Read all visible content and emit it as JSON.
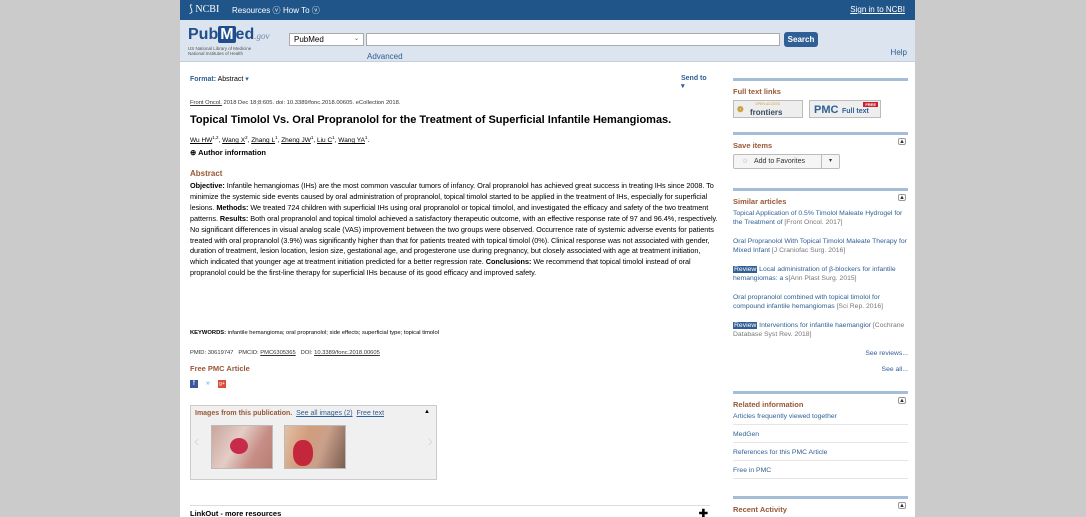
{
  "topbar": {
    "logo": "NCBI",
    "resources": "Resources ⓥ",
    "howto": "How To ⓥ",
    "signin": "Sign in to NCBI"
  },
  "search": {
    "brand_pub": "Pub",
    "brand_m": "M",
    "brand_ed": "ed",
    "brand_gov": ".gov",
    "nlm1": "US National Library of Medicine",
    "nlm2": "National Institutes of Health",
    "db": "PubMed",
    "query": "",
    "button": "Search",
    "advanced": "Advanced",
    "help": "Help"
  },
  "article": {
    "format_label": "Format:",
    "format_value": "Abstract",
    "send_to": "Send to",
    "journal": "Front Oncol.",
    "citation_rest": " 2018 Dec 18;8:605. doi: 10.3389/fonc.2018.00605. eCollection 2018.",
    "title": "Topical Timolol Vs. Oral Propranolol for the Treatment of Superficial Infantile Hemangiomas.",
    "authors": [
      {
        "name": "Wu HW",
        "sup": "1,2"
      },
      {
        "name": "Wang X",
        "sup": "2"
      },
      {
        "name": "Zhang L",
        "sup": "1"
      },
      {
        "name": "Zheng JW",
        "sup": "1"
      },
      {
        "name": "Liu C",
        "sup": "1"
      },
      {
        "name": "Wang YA",
        "sup": "1"
      }
    ],
    "author_info": "Author information",
    "abstract_heading": "Abstract",
    "objective_label": "Objective:",
    "objective": " Infantile hemangiomas (IHs) are the most common vascular tumors of infancy. Oral propranolol has achieved great success in treating IHs since 2008. To minimize the systemic side events caused by oral administration of propranolol, topical timolol started to be applied in the treatment of IHs, especially for superficial lesions. ",
    "methods_label": "Methods:",
    "methods": " We treated 724 children with superficial IHs using oral propranolol or topical timolol, and investigated the efficacy and safety of the two treatment patterns. ",
    "results_label": "Results:",
    "results": " Both oral propranolol and topical timolol achieved a satisfactory therapeutic outcome, with an effective response rate of 97 and 96.4%, respectively. No significant differences in visual analog scale (VAS) improvement between the two groups were observed. Occurrence rate of systemic adverse events for patients treated with oral propranolol (3.9%) was significantly higher than that for patients treated with topical timolol (0%). Clinical response was not associated with gender, duration of treatment, lesion location, lesion size, gestational age, and progesterone use during pregnancy, but closely associated with age at treatment initiation, which indicated that younger age at treatment initiation predicted for a better regression rate. ",
    "conclusions_label": "Conclusions:",
    "conclusions": " We recommend that topical timolol instead of oral propranolol could be the first-line therapy for superficial IHs because of its good efficacy and improved safety.",
    "keywords_label": "KEYWORDS:",
    "keywords": " infantile hemangioma; oral propranolol; side effects; superficial type; topical timolol",
    "pmid": "PMID: 30619747",
    "pmcid_label": "PMCID: ",
    "pmcid": "PMC6305365",
    "doi_label": "DOI: ",
    "doi": "10.3389/fonc.2018.00605",
    "free_pmc": "Free PMC Article"
  },
  "images": {
    "title": "Images from this publication.",
    "see_all": "See all images (2)",
    "free_text": "Free text"
  },
  "linkout": "LinkOut - more resources",
  "sidebar": {
    "full_text_links": "Full text links",
    "frontiers_oa": "OPEN ACCESS",
    "frontiers": "frontiers",
    "pmc": "PMC",
    "pmc_free": "FREE",
    "pmc_fulltext": "Full text",
    "save_items": "Save items",
    "add_favorites": "Add to Favorites",
    "similar_articles": "Similar articles",
    "similar": [
      {
        "review": false,
        "title": "Topical Application of 0.5% Timolol Maleate Hydrogel for the Treatment of ",
        "src": "[Front Oncol. 2017]"
      },
      {
        "review": false,
        "title": "Oral Propranolol With Topical Timolol Maleate Therapy for Mixed Infant ",
        "src": "[J Craniofac Surg. 2016]"
      },
      {
        "review": true,
        "review_label": "Review",
        "title": " Local administration of β-blockers for infantile hemangiomas: a s",
        "src": "[Ann Plast Surg. 2015]"
      },
      {
        "review": false,
        "title": "Oral propranolol combined with topical timolol for compound infantile hemangiomas ",
        "src": "[Sci Rep. 2016]"
      },
      {
        "review": true,
        "review_label": "Review",
        "title": " Interventions for infantile haemangior ",
        "src": "[Cochrane Database Syst Rev. 2018]"
      }
    ],
    "see_reviews": "See reviews...",
    "see_all": "See all...",
    "related_information": "Related information",
    "related": [
      "Articles frequently viewed together",
      "MedGen",
      "References for this PMC Article",
      "Free in PMC"
    ],
    "recent_activity": "Recent Activity"
  }
}
